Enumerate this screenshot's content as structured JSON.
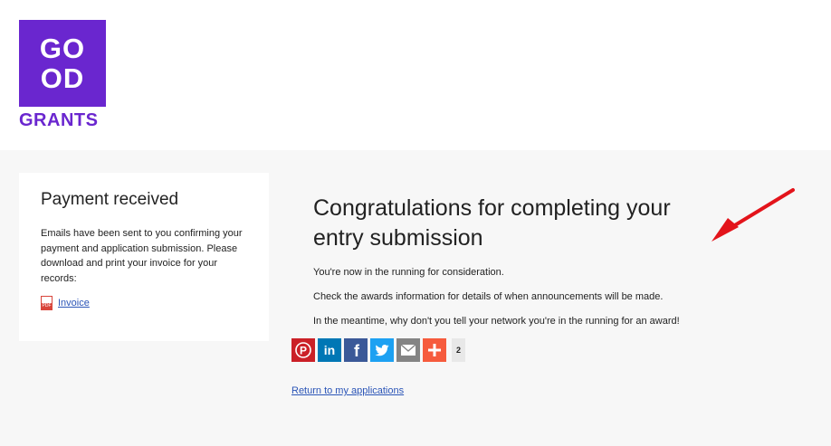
{
  "logo": {
    "line1": "GO",
    "line2": "OD",
    "wordmark": "GRANTS",
    "color": "#6a26cf"
  },
  "payment_card": {
    "title": "Payment received",
    "body": "Emails have been sent to you confirming your payment and application submission. Please download and print your invoice for your records:",
    "invoice_label": "Invoice",
    "invoice_icon": "pdf-icon"
  },
  "main": {
    "title": "Congratulations for completing your entry submission",
    "messages": [
      "You're now in the running for consideration.",
      "Check the awards information for details of when announcements will be made.",
      "In the meantime, why don't you tell your network you're in the running for an award!"
    ]
  },
  "share": {
    "buttons": [
      {
        "icon": "pinterest-icon",
        "color": "#cb2027"
      },
      {
        "icon": "linkedin-icon",
        "color": "#0077b5"
      },
      {
        "icon": "facebook-icon",
        "color": "#3b5998"
      },
      {
        "icon": "twitter-icon",
        "color": "#1da1f2"
      },
      {
        "icon": "email-icon",
        "color": "#848484"
      },
      {
        "icon": "more-icon",
        "color": "#f65b3d"
      }
    ],
    "count": "2"
  },
  "return_link": "Return to my applications",
  "annotation": {
    "icon": "red-arrow-icon",
    "color": "#e3141b"
  }
}
